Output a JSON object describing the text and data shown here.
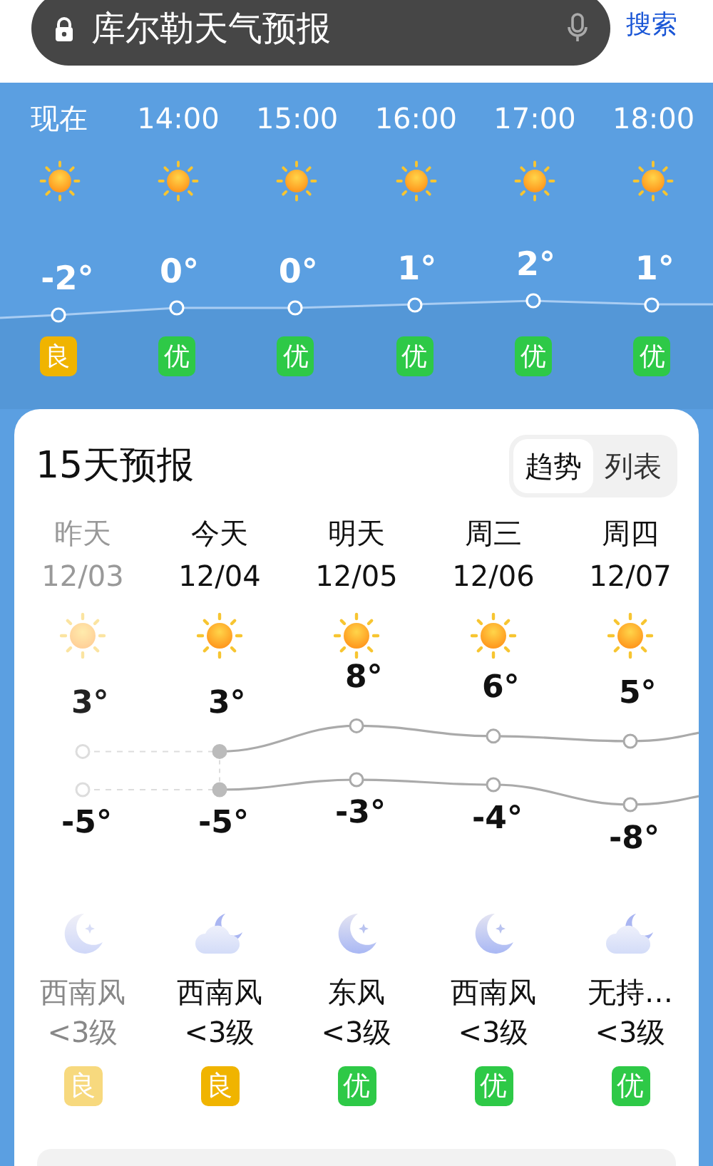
{
  "search": {
    "query": "库尔勒天气预报",
    "button": "搜索"
  },
  "hourly": [
    {
      "time": "现在",
      "temp": "-2°",
      "aqi": {
        "label": "良",
        "kind": "good"
      }
    },
    {
      "time": "14:00",
      "temp": "0°",
      "aqi": {
        "label": "优",
        "kind": "excellent"
      }
    },
    {
      "time": "15:00",
      "temp": "0°",
      "aqi": {
        "label": "优",
        "kind": "excellent"
      }
    },
    {
      "time": "16:00",
      "temp": "1°",
      "aqi": {
        "label": "优",
        "kind": "excellent"
      }
    },
    {
      "time": "17:00",
      "temp": "2°",
      "aqi": {
        "label": "优",
        "kind": "excellent"
      }
    },
    {
      "time": "18:00",
      "temp": "1°",
      "aqi": {
        "label": "优",
        "kind": "excellent"
      }
    }
  ],
  "forecast": {
    "title": "15天预报",
    "view_tabs": [
      {
        "label": "趋势",
        "selected": true
      },
      {
        "label": "列表",
        "selected": false
      }
    ],
    "days": [
      {
        "day": "昨天",
        "date": "12/03",
        "past": true,
        "high": "3°",
        "low": "-5°",
        "night": {
          "kind": "moon"
        },
        "wind": "西南风",
        "wind_level": "<3级",
        "aqi": {
          "label": "良",
          "kind": "good"
        }
      },
      {
        "day": "今天",
        "date": "12/04",
        "past": false,
        "high": "3°",
        "low": "-5°",
        "night": {
          "kind": "cloudy_moon"
        },
        "wind": "西南风",
        "wind_level": "<3级",
        "aqi": {
          "label": "良",
          "kind": "good"
        }
      },
      {
        "day": "明天",
        "date": "12/05",
        "past": false,
        "high": "8°",
        "low": "-3°",
        "night": {
          "kind": "moon"
        },
        "wind": "东风",
        "wind_level": "<3级",
        "aqi": {
          "label": "优",
          "kind": "excellent"
        }
      },
      {
        "day": "周三",
        "date": "12/06",
        "past": false,
        "high": "6°",
        "low": "-4°",
        "night": {
          "kind": "moon"
        },
        "wind": "西南风",
        "wind_level": "<3级",
        "aqi": {
          "label": "优",
          "kind": "excellent"
        }
      },
      {
        "day": "周四",
        "date": "12/07",
        "past": false,
        "high": "5°",
        "low": "-8°",
        "night": {
          "kind": "cloudy_moon"
        },
        "wind": "无持…",
        "wind_level": "<3级",
        "aqi": {
          "label": "优",
          "kind": "excellent"
        }
      }
    ]
  }
}
